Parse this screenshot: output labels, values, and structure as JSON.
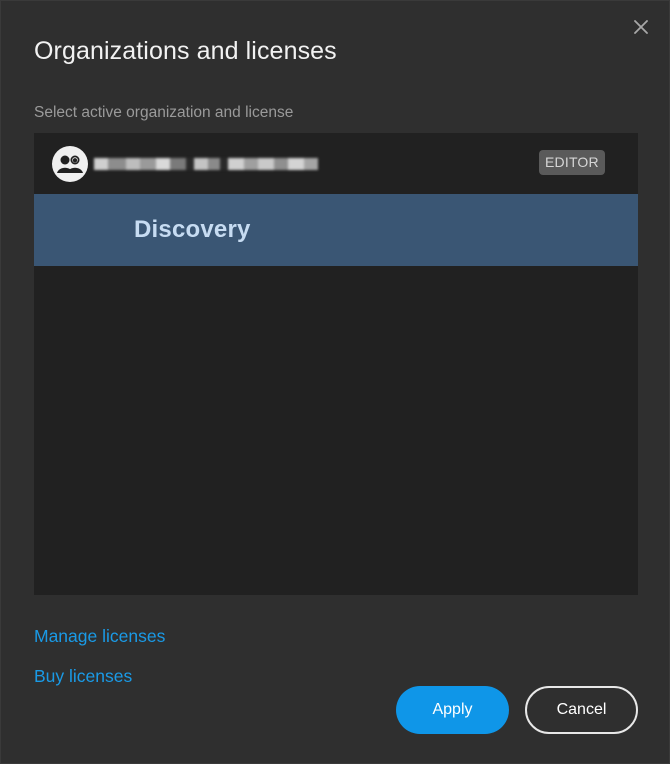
{
  "dialog": {
    "title": "Organizations and licenses",
    "subtitle": "Select active organization and license",
    "close_icon": "close-icon"
  },
  "organization": {
    "icon": "organization-icon",
    "name_pixelated": true,
    "role_badge": "EDITOR"
  },
  "licenses": [
    {
      "label": "Discovery",
      "selected": true
    }
  ],
  "links": {
    "manage": "Manage licenses",
    "buy": "Buy licenses"
  },
  "buttons": {
    "apply": "Apply",
    "cancel": "Cancel"
  },
  "colors": {
    "background": "#2f2f2f",
    "list_bg": "#212121",
    "selected_row": "#3a5674",
    "accent": "#0f96e8",
    "link": "#1a9ae6"
  }
}
